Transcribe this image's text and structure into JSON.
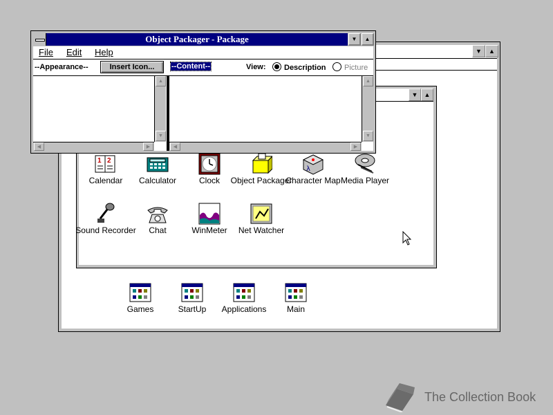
{
  "program_manager": {
    "accessories": {
      "icons": [
        {
          "label": "Calendar"
        },
        {
          "label": "Calculator"
        },
        {
          "label": "Clock"
        },
        {
          "label": "Object Packager"
        },
        {
          "label": "Character Map"
        },
        {
          "label": "Media Player"
        },
        {
          "label": "Sound Recorder"
        },
        {
          "label": "Chat"
        },
        {
          "label": "WinMeter"
        },
        {
          "label": "Net Watcher"
        }
      ]
    },
    "group_icons": [
      {
        "label": "Games"
      },
      {
        "label": "StartUp"
      },
      {
        "label": "Applications"
      },
      {
        "label": "Main"
      }
    ]
  },
  "packager": {
    "title": "Object Packager - Package",
    "menu": [
      "File",
      "Edit",
      "Help"
    ],
    "appearance_label": "--Appearance--",
    "insert_icon_button": "Insert Icon...",
    "content_label": "--Content--",
    "view_label": "View:",
    "view_options": [
      "Description",
      "Picture"
    ],
    "view_selected": "Description"
  },
  "watermark": {
    "text": "The Collection Book"
  }
}
